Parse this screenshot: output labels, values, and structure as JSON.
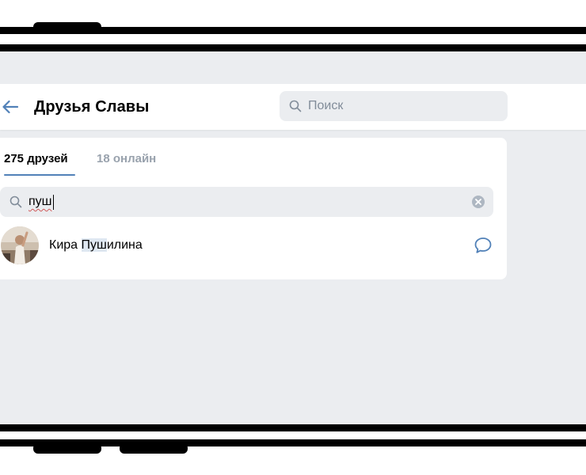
{
  "header": {
    "title": "Друзья Славы",
    "search_placeholder": "Поиск",
    "back_icon": "arrow-left-icon"
  },
  "tabs": [
    {
      "label": "275 друзей",
      "active": true
    },
    {
      "label": "18 онлайн",
      "active": false
    }
  ],
  "friend_search": {
    "value": "пуш",
    "icon": "search-icon",
    "clear_icon": "clear-icon"
  },
  "friends": [
    {
      "name_before": "Кира ",
      "name_match": "Пуш",
      "name_after": "илина",
      "action_icon": "message-icon"
    }
  ],
  "colors": {
    "accent": "#5181b8",
    "screen_bg": "#ebedf0",
    "search_bg": "#ebedf0",
    "muted_text": "#99a2ad",
    "highlight": "#dfe8f2"
  }
}
